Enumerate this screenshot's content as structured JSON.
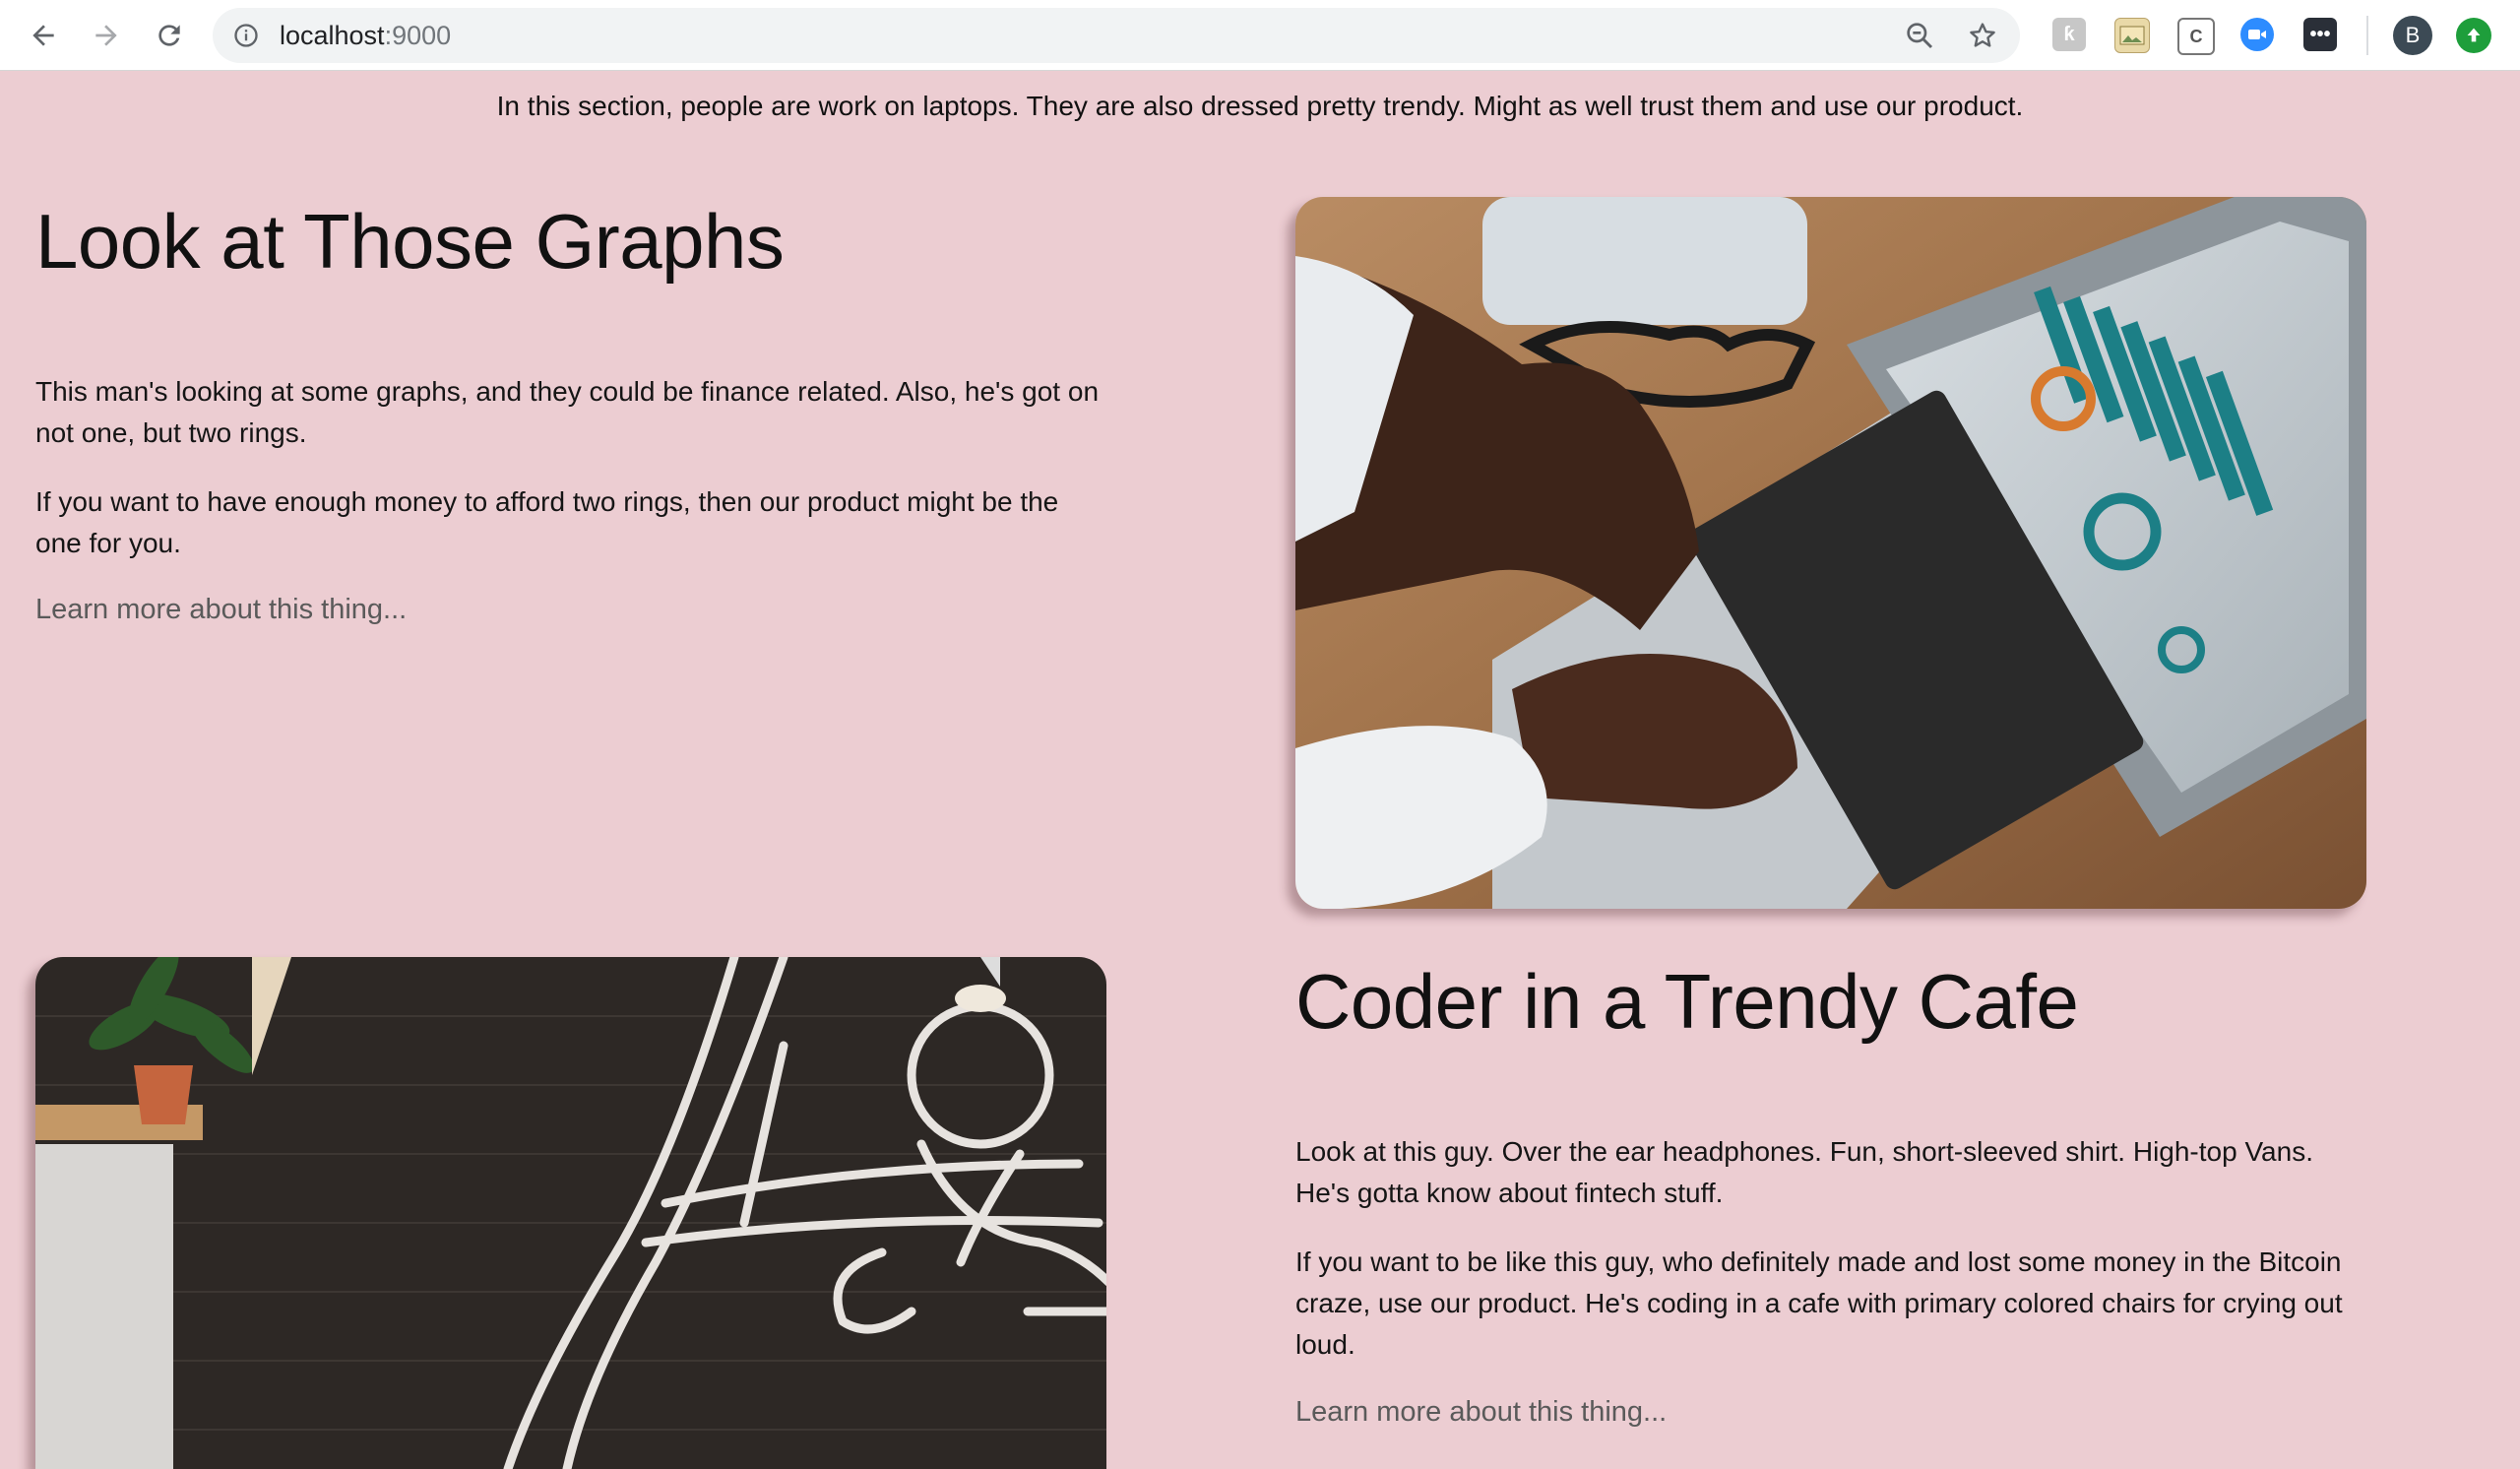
{
  "browser": {
    "url_host": "localhost",
    "url_port": ":9000",
    "profile_initial": "B",
    "icons": {
      "back": "arrow-left-icon",
      "forward": "arrow-right-icon",
      "reload": "reload-icon",
      "site_info": "info-icon",
      "zoom": "zoom-out-icon",
      "bookmark": "star-icon",
      "extensions": [
        "puzzle-extension-icon",
        "image-extension-icon",
        "c-extension-icon",
        "video-extension-icon",
        "dots-extension-icon"
      ],
      "update": "update-arrow-icon"
    }
  },
  "page": {
    "intro": "In this section, people are work on laptops. They are also dressed pretty trendy. Might as well trust them and use our product.",
    "background_color": "#eccdd2",
    "sections": [
      {
        "title": "Look at Those Graphs",
        "paragraphs": [
          "This man's looking at some graphs, and they could be finance related. Also, he's got on not one, but two rings.",
          "If you want to have enough money to afford two rings, then our product might be the one for you."
        ],
        "link": "Learn more about this thing...",
        "image": "laptop-graphs-photo"
      },
      {
        "title": "Coder in a Trendy Cafe",
        "paragraphs": [
          "Look at this guy. Over the ear headphones. Fun, short-sleeved shirt. High-top Vans. He's gotta know about fintech stuff.",
          "If you want to be like this guy, who definitely made and lost some money in the Bitcoin craze, use our product. He's coding in a cafe with primary colored chairs for crying out loud."
        ],
        "link": "Learn more about this thing...",
        "image": "cafe-mural-photo"
      }
    ]
  }
}
